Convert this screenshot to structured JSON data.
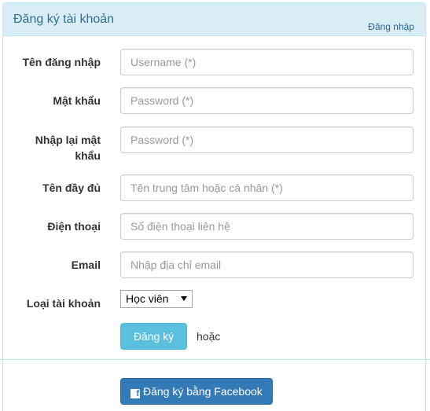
{
  "panel": {
    "title": "Đăng ký tài khoản",
    "login_link": "Đăng nhập"
  },
  "form": {
    "username": {
      "label": "Tên đăng nhập",
      "placeholder": "Username (*)",
      "value": ""
    },
    "password": {
      "label": "Mật khẩu",
      "placeholder": "Password (*)",
      "value": ""
    },
    "confirm_password": {
      "label_line1": "Nhập lại mật",
      "label_line2": "khẩu",
      "placeholder": "Password (*)",
      "value": ""
    },
    "full_name": {
      "label": "Tên đầy đủ",
      "placeholder": "Tên trung tâm hoặc cá nhân (*)",
      "value": ""
    },
    "phone": {
      "label": "Điện thoại",
      "placeholder": "Số điện thoại liên hệ",
      "value": ""
    },
    "email": {
      "label": "Email",
      "placeholder": "Nhập địa chỉ email",
      "value": ""
    },
    "account_type": {
      "label": "Loại tài khoản",
      "selected": "Học viên"
    },
    "register_button": "Đăng ký",
    "or_text": "hoặc",
    "facebook_button": "Đăng ký bằng Facebook",
    "facebook_icon_glyph": "f"
  },
  "colors": {
    "heading_bg": "#d9edf7",
    "heading_text": "#31708f",
    "register_button": "#5bc0de",
    "facebook_button": "#337ab7"
  }
}
